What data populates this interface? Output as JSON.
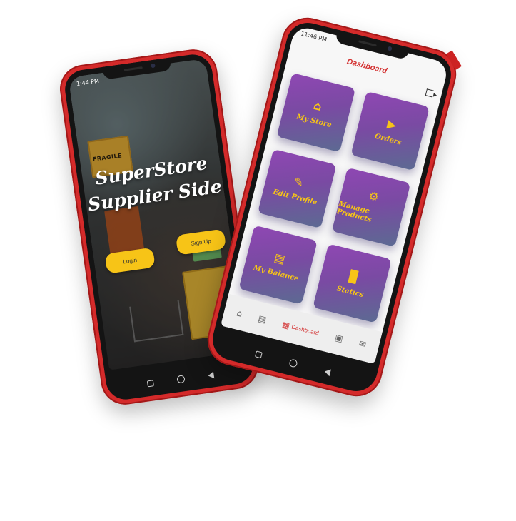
{
  "left_phone": {
    "status_time": "1:44 PM",
    "title_line1": "SuperStore",
    "title_line2": "Supplier Side",
    "fragile_label": "FRAGILE",
    "login_label": "Login",
    "signup_label": "Sign Up"
  },
  "right_phone": {
    "status_time": "11:46 PM",
    "page_title": "Dashboard",
    "tiles": [
      {
        "label": "My Store",
        "icon": "store-icon"
      },
      {
        "label": "Orders",
        "icon": "shopping-bag-icon"
      },
      {
        "label": "Edit Profile",
        "icon": "pencil-icon"
      },
      {
        "label": "Manage Products",
        "icon": "gear-icon"
      },
      {
        "label": "My Balance",
        "icon": "wallet-icon"
      },
      {
        "label": "Statics",
        "icon": "bar-chart-icon"
      }
    ],
    "bottom_nav": {
      "active_label": "Dashboard"
    }
  },
  "colors": {
    "accent_red": "#d32f2f",
    "accent_yellow": "#f7c417",
    "tile_purple": "#8f47b3"
  }
}
